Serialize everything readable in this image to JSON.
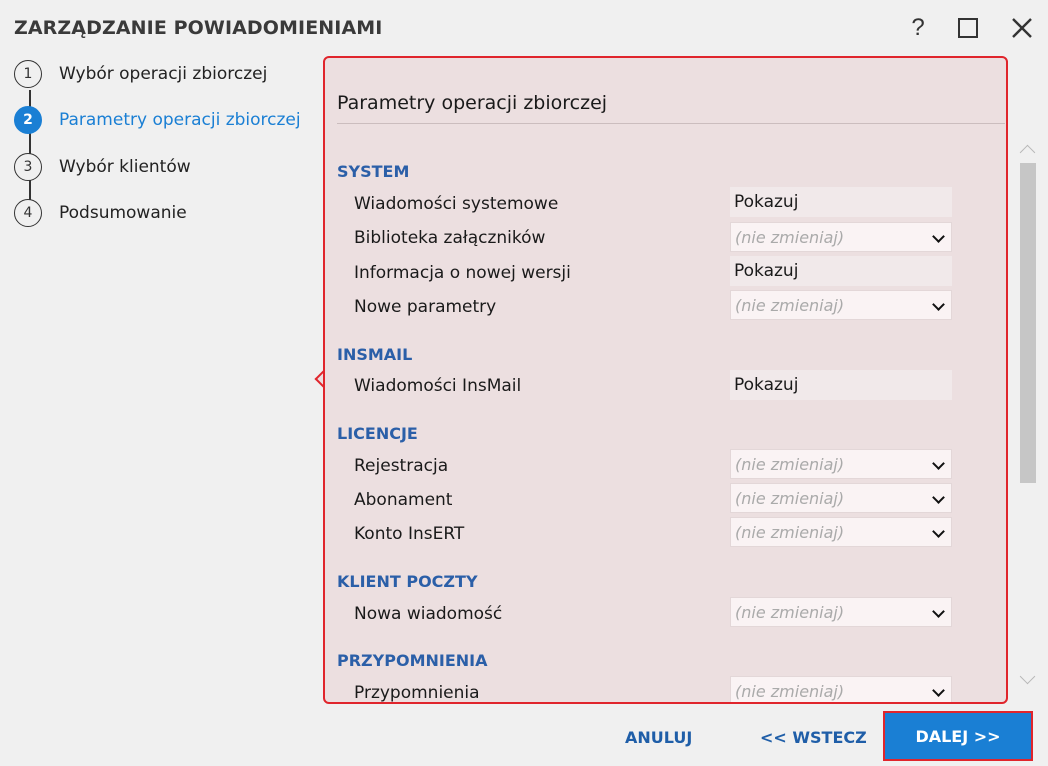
{
  "window": {
    "title": "ZARZĄDZANIE POWIADOMIENIAMI",
    "help_glyph": "?",
    "icons": [
      "help-icon",
      "maximize-icon",
      "close-icon"
    ]
  },
  "steps": [
    {
      "number": "1",
      "label": "Wybór operacji zbiorczej",
      "active": false
    },
    {
      "number": "2",
      "label": "Parametry operacji zbiorczej",
      "active": true
    },
    {
      "number": "3",
      "label": "Wybór klientów",
      "active": false
    },
    {
      "number": "4",
      "label": "Podsumowanie",
      "active": false
    }
  ],
  "panel": {
    "title": "Parametry operacji zbiorczej",
    "sections": [
      {
        "name": "SYSTEM",
        "rows": [
          {
            "label": "Wiadomości systemowe",
            "value": "Pokazuj",
            "type": "text"
          },
          {
            "label": "Biblioteka załączników",
            "value": "(nie zmieniaj)",
            "type": "select"
          },
          {
            "label": "Informacja o nowej wersji",
            "value": "Pokazuj",
            "type": "text"
          },
          {
            "label": "Nowe parametry",
            "value": "(nie zmieniaj)",
            "type": "select"
          }
        ]
      },
      {
        "name": "INSMAIL",
        "rows": [
          {
            "label": "Wiadomości InsMail",
            "value": "Pokazuj",
            "type": "text"
          }
        ]
      },
      {
        "name": "LICENCJE",
        "rows": [
          {
            "label": "Rejestracja",
            "value": "(nie zmieniaj)",
            "type": "select"
          },
          {
            "label": "Abonament",
            "value": "(nie zmieniaj)",
            "type": "select"
          },
          {
            "label": "Konto InsERT",
            "value": "(nie zmieniaj)",
            "type": "select"
          }
        ]
      },
      {
        "name": "KLIENT POCZTY",
        "rows": [
          {
            "label": "Nowa wiadomość",
            "value": "(nie zmieniaj)",
            "type": "select"
          }
        ]
      },
      {
        "name": "PRZYPOMNIENIA",
        "rows": [
          {
            "label": "Przypomnienia",
            "value": "(nie zmieniaj)",
            "type": "select"
          }
        ]
      }
    ]
  },
  "footer": {
    "cancel_label": "ANULUJ",
    "back_label": "<< WSTECZ",
    "next_label": "DALEJ >>"
  },
  "colors": {
    "accent": "#1a7fd4",
    "section_heading": "#2b5fa8",
    "highlight_border": "#e0252c"
  }
}
